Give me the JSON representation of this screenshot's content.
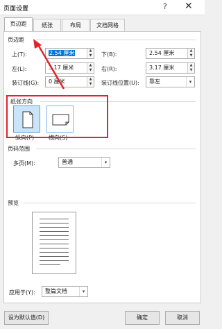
{
  "window": {
    "title": "页面设置",
    "help": "?",
    "close": "✕"
  },
  "tabs": [
    {
      "label": "页边距",
      "active": true
    },
    {
      "label": "纸张"
    },
    {
      "label": "布局"
    },
    {
      "label": "文档网格"
    }
  ],
  "margins": {
    "section": "页边距",
    "top": {
      "label": "上(T):",
      "value": "2.54 厘米"
    },
    "bottom": {
      "label": "下(B):",
      "value": "2.54 厘米"
    },
    "left": {
      "label": "左(L):",
      "value": "3.17 厘米"
    },
    "right": {
      "label": "右(R):",
      "value": "3.17 厘米"
    },
    "gutter": {
      "label": "装订线(G):",
      "value": "0 厘米"
    },
    "gutter_position": {
      "label": "装订线位置(U):",
      "value": "靠左"
    }
  },
  "orientation": {
    "section": "纸张方向",
    "portrait": "纵向(P)",
    "landscape": "横向(S)",
    "selected": "portrait"
  },
  "pages": {
    "section": "页码范围",
    "multiple_label": "多页(M):",
    "multiple_value": "普通"
  },
  "preview": {
    "section": "预览"
  },
  "apply": {
    "label": "应用于(Y):",
    "value": "整篇文档"
  },
  "buttons": {
    "default": "设为默认值(D)",
    "ok": "确定",
    "cancel": "取消"
  },
  "annotation_color": "#e0242a"
}
